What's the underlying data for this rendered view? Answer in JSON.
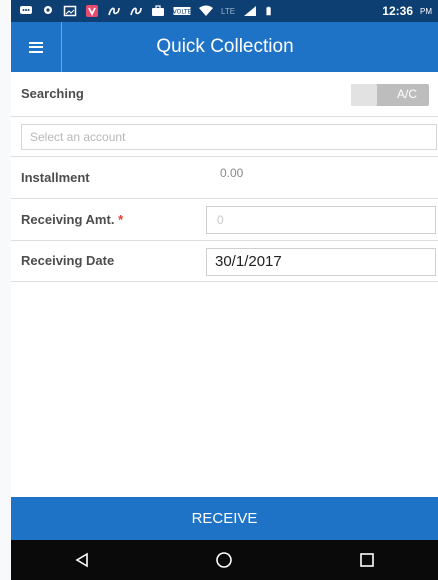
{
  "status_bar": {
    "time": "12:36",
    "ampm": "PM",
    "network": "LTE",
    "icons": [
      "message-icon",
      "location-icon",
      "image-icon",
      "vivaldi-icon",
      "app-icon",
      "app-icon",
      "briefcase-icon",
      "volte-icon",
      "wifi-icon",
      "signal-icon",
      "battery-icon"
    ]
  },
  "app_bar": {
    "title": "Quick Collection"
  },
  "form": {
    "searching_label": "Searching",
    "toggle_label": "A/C",
    "account_placeholder": "Select an account",
    "installment_label": "Installment",
    "installment_value": "0.00",
    "receiving_amt_label": "Receiving Amt.",
    "required_mark": "*",
    "receiving_amt_placeholder": "0",
    "receiving_date_label": "Receiving Date",
    "receiving_date_value": "30/1/2017"
  },
  "actions": {
    "receive_label": "RECEIVE"
  },
  "colors": {
    "primary": "#1f73c6",
    "status_bar": "#0d3f73",
    "required": "#e53935"
  }
}
